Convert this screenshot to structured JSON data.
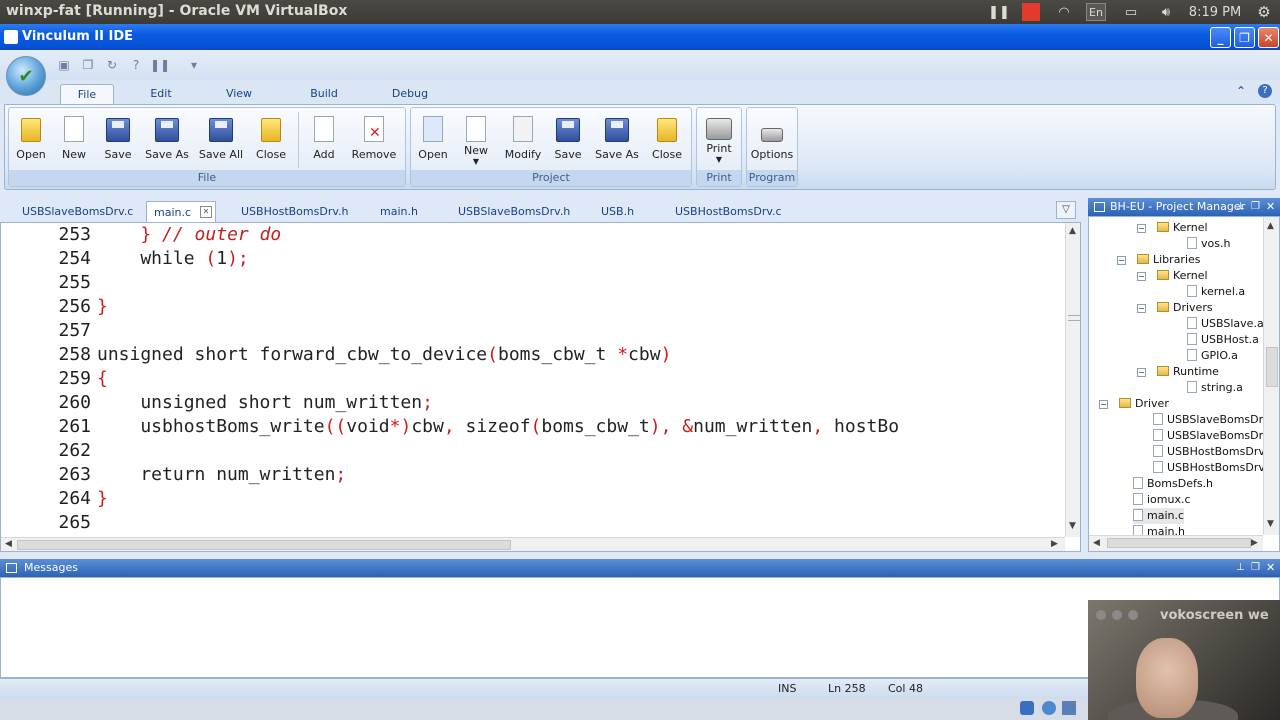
{
  "os_bar": {
    "title": "winxp-fat [Running] - Oracle VM VirtualBox",
    "keyboard_layout": "En",
    "time": "8:19 PM"
  },
  "window": {
    "title": "Vinculum II IDE"
  },
  "ribbon": {
    "tabs": [
      "File",
      "Edit",
      "View",
      "Build",
      "Debug"
    ],
    "active_tab": "File",
    "groups": {
      "file": {
        "label": "File",
        "buttons": [
          "Open",
          "New",
          "Save",
          "Save As",
          "Save All",
          "Close"
        ]
      },
      "file_tools": {
        "buttons": [
          "Add",
          "Remove"
        ]
      },
      "project": {
        "label": "Project",
        "buttons": [
          "Open",
          "New",
          "Modify",
          "Save",
          "Save As",
          "Close"
        ]
      },
      "print": {
        "label": "Print",
        "buttons": [
          "Print"
        ]
      },
      "program": {
        "label": "Program",
        "buttons": [
          "Options"
        ]
      }
    }
  },
  "editor_tabs": [
    "USBSlaveBomsDrv.c",
    "main.c",
    "USBHostBomsDrv.h",
    "main.h",
    "USBSlaveBomsDrv.h",
    "USB.h",
    "USBHostBomsDrv.c"
  ],
  "active_editor_tab": "main.c",
  "code_lines": [
    {
      "num": "253",
      "code": "    } // outer do"
    },
    {
      "num": "254",
      "code": "    while (1);"
    },
    {
      "num": "255",
      "code": ""
    },
    {
      "num": "256",
      "code": "}"
    },
    {
      "num": "257",
      "code": ""
    },
    {
      "num": "258",
      "code": "unsigned short forward_cbw_to_device(boms_cbw_t *cbw)"
    },
    {
      "num": "259",
      "code": "{"
    },
    {
      "num": "260",
      "code": "    unsigned short num_written;"
    },
    {
      "num": "261",
      "code": "    usbhostBoms_write((void*)cbw, sizeof(boms_cbw_t), &num_written, hostBo"
    },
    {
      "num": "262",
      "code": ""
    },
    {
      "num": "263",
      "code": "    return num_written;"
    },
    {
      "num": "264",
      "code": "}"
    },
    {
      "num": "265",
      "code": ""
    }
  ],
  "project_manager": {
    "title": "BH-EU - Project Manager",
    "nodes": [
      "Kernel",
      "vos.h",
      "Libraries",
      "Kernel",
      "kernel.a",
      "Drivers",
      "USBSlave.a",
      "USBHost.a",
      "GPIO.a",
      "Runtime",
      "string.a",
      "Driver",
      "USBSlaveBomsDrv.h",
      "USBSlaveBomsDrv.c",
      "USBHostBomsDrv.c",
      "USBHostBomsDrv.h",
      "BomsDefs.h",
      "iomux.c",
      "main.c",
      "main.h"
    ]
  },
  "messages": {
    "title": "Messages"
  },
  "status": {
    "mode": "INS",
    "line": "Ln 258",
    "col": "Col 48"
  },
  "overlay": {
    "caption": "vokoscreen we"
  },
  "colors": {
    "accent": "#2c62b5",
    "code_punct": "#d01a1a"
  }
}
